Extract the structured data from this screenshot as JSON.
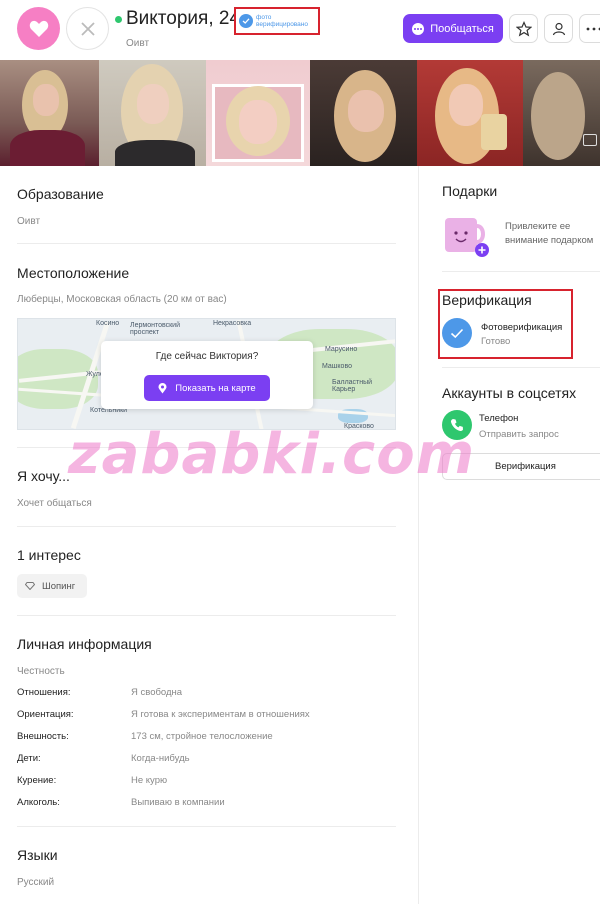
{
  "header": {
    "name": "Виктория, 24",
    "city": "Оивт",
    "verified_badge_text": "фото верифицировано",
    "chat_label": "Пообщаться",
    "colors": {
      "like": "#f67fc4",
      "accent": "#7b3ff2",
      "online": "#2ec76e",
      "verified": "#4d98e8",
      "highlight": "#d7232e"
    }
  },
  "photos": [
    {
      "name": "photo-1"
    },
    {
      "name": "photo-2"
    },
    {
      "name": "photo-3"
    },
    {
      "name": "photo-4"
    },
    {
      "name": "photo-5"
    },
    {
      "name": "photo-6"
    }
  ],
  "education": {
    "title": "Образование",
    "value": "Оивт"
  },
  "location": {
    "title": "Местоположение",
    "value": "Люберцы, Московская область (20 км от вас)",
    "map_question": "Где сейчас Виктория?",
    "map_button": "Показать на карте",
    "map_labels": [
      "Косино",
      "Лермонтовский проспект",
      "Некрасовка",
      "Марусино",
      "Машково",
      "Балластный Карьер",
      "Котельники",
      "Жулебино",
      "Красково"
    ]
  },
  "wants": {
    "title": "Я хочу...",
    "value": "Хочет общаться"
  },
  "interests": {
    "title": "1 интерес",
    "items": [
      "Шопинг"
    ]
  },
  "personal": {
    "title": "Личная информация",
    "subtitle": "Честность",
    "rows": [
      {
        "key": "Отношения:",
        "value": "Я свободна"
      },
      {
        "key": "Ориентация:",
        "value": "Я готова к экспериментам в отношениях"
      },
      {
        "key": "Внешность:",
        "value": "173 см, стройное телосложение"
      },
      {
        "key": "Дети:",
        "value": "Когда-нибудь"
      },
      {
        "key": "Курение:",
        "value": "Не курю"
      },
      {
        "key": "Алкоголь:",
        "value": "Выпиваю в компании"
      }
    ]
  },
  "languages": {
    "title": "Языки",
    "value": "Русский"
  },
  "gifts": {
    "title": "Подарки",
    "line1": "Привлеките ее",
    "line2": "внимание подарком"
  },
  "verification": {
    "title": "Верификация",
    "item": "Фотоверификация",
    "status": "Готово"
  },
  "social": {
    "title": "Аккаунты в соцсетях",
    "phone_label": "Телефон",
    "phone_action": "Отправить запрос",
    "button": "Верификация"
  },
  "watermark": "zababki.com"
}
